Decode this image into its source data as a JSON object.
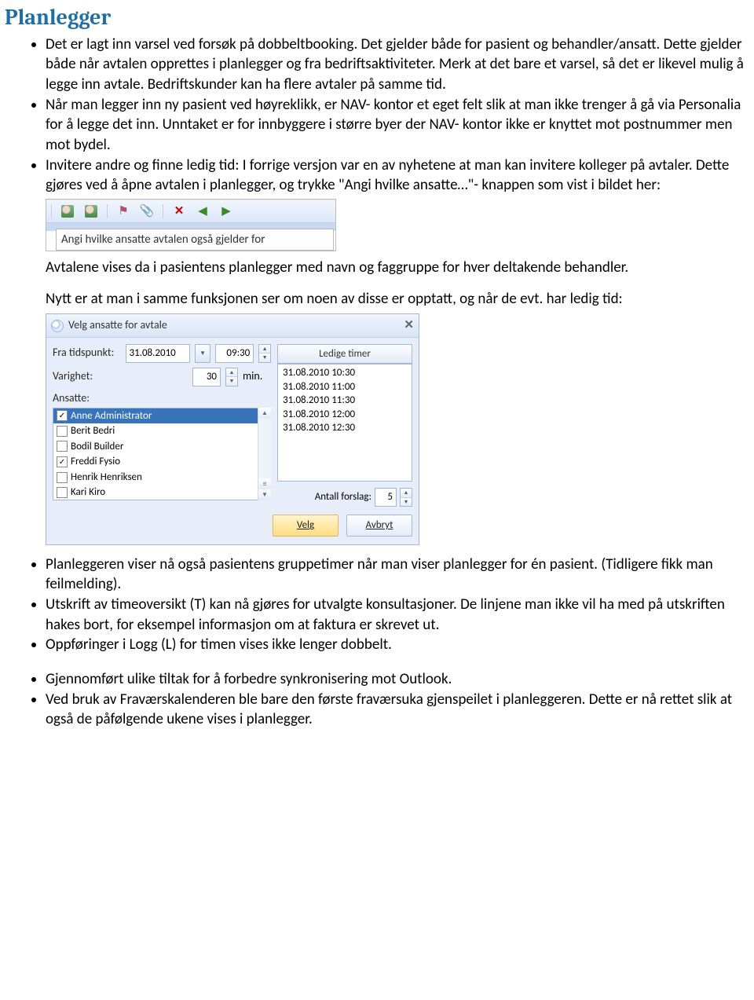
{
  "title": "Planlegger",
  "bullets_a": [
    "Det er lagt inn varsel ved forsøk på dobbeltbooking. Det gjelder både for pasient og behandler/ansatt. Dette gjelder både når avtalen opprettes i planlegger og fra bedriftsaktiviteter. Merk at det bare et varsel, så det er likevel mulig å legge inn avtale. Bedriftskunder kan ha flere avtaler på samme tid.",
    "Når man legger inn ny pasient ved høyreklikk, er NAV- kontor et eget felt slik at man ikke trenger å gå via Personalia for å legge det inn. Unntaket er for innbyggere i større byer der NAV- kontor ikke er knyttet mot postnummer men mot bydel.",
    "Invitere andre og finne ledig tid: I forrige versjon var en av nyhetene at man kan invitere kolleger på avtaler. Dette gjøres ved å åpne avtalen i planlegger, og trykke \"Angi hvilke ansatte…\"- knappen som vist i bildet her:"
  ],
  "tooltip": "Angi hvilke ansatte avtalen også gjelder for",
  "para_after_shot1": "Avtalene vises da i pasientens planlegger med navn og faggruppe for hver deltakende behandler.",
  "para_before_shot2": "Nytt er at man i samme funksjonen ser om noen av disse er opptatt, og når de evt. har ledig tid:",
  "dialog": {
    "title": "Velg ansatte for avtale",
    "fra_label": "Fra tidspunkt:",
    "fra_date": "31.08.2010",
    "fra_time": "09:30",
    "varighet_label": "Varighet:",
    "varighet_value": "30",
    "varighet_unit": "min.",
    "ansatte_label": "Ansatte:",
    "ansatte": [
      {
        "name": "Anne Administrator",
        "checked": true,
        "selected": true
      },
      {
        "name": "Berit Bedri",
        "checked": false,
        "selected": false
      },
      {
        "name": "Bodil Builder",
        "checked": false,
        "selected": false
      },
      {
        "name": "Freddi Fysio",
        "checked": true,
        "selected": false
      },
      {
        "name": "Henrik Henriksen",
        "checked": false,
        "selected": false
      },
      {
        "name": "Kari Kiro",
        "checked": false,
        "selected": false
      }
    ],
    "ledige_label": "Ledige timer",
    "ledige": [
      "31.08.2010 10:30",
      "31.08.2010 11:00",
      "31.08.2010 11:30",
      "31.08.2010 12:00",
      "31.08.2010 12:30"
    ],
    "antall_label": "Antall forslag:",
    "antall_value": "5",
    "velg": "Velg",
    "avbryt": "Avbryt"
  },
  "bullets_b": [
    "Planleggeren viser nå også pasientens gruppetimer når man viser planlegger for én pasient. (Tidligere fikk man feilmelding).",
    "Utskrift av timeoversikt (T) kan nå gjøres for utvalgte konsultasjoner. De linjene man ikke vil ha med på utskriften hakes bort, for eksempel informasjon om at faktura er skrevet ut.",
    "Oppføringer i Logg (L) for timen vises ikke lenger dobbelt."
  ],
  "bullets_c": [
    "Gjennomført ulike tiltak for å forbedre synkronisering mot Outlook.",
    "Ved bruk av Fraværskalenderen ble bare den første fraværsuka gjenspeilet i planleggeren. Dette er nå rettet slik at også de påfølgende ukene vises i planlegger."
  ]
}
